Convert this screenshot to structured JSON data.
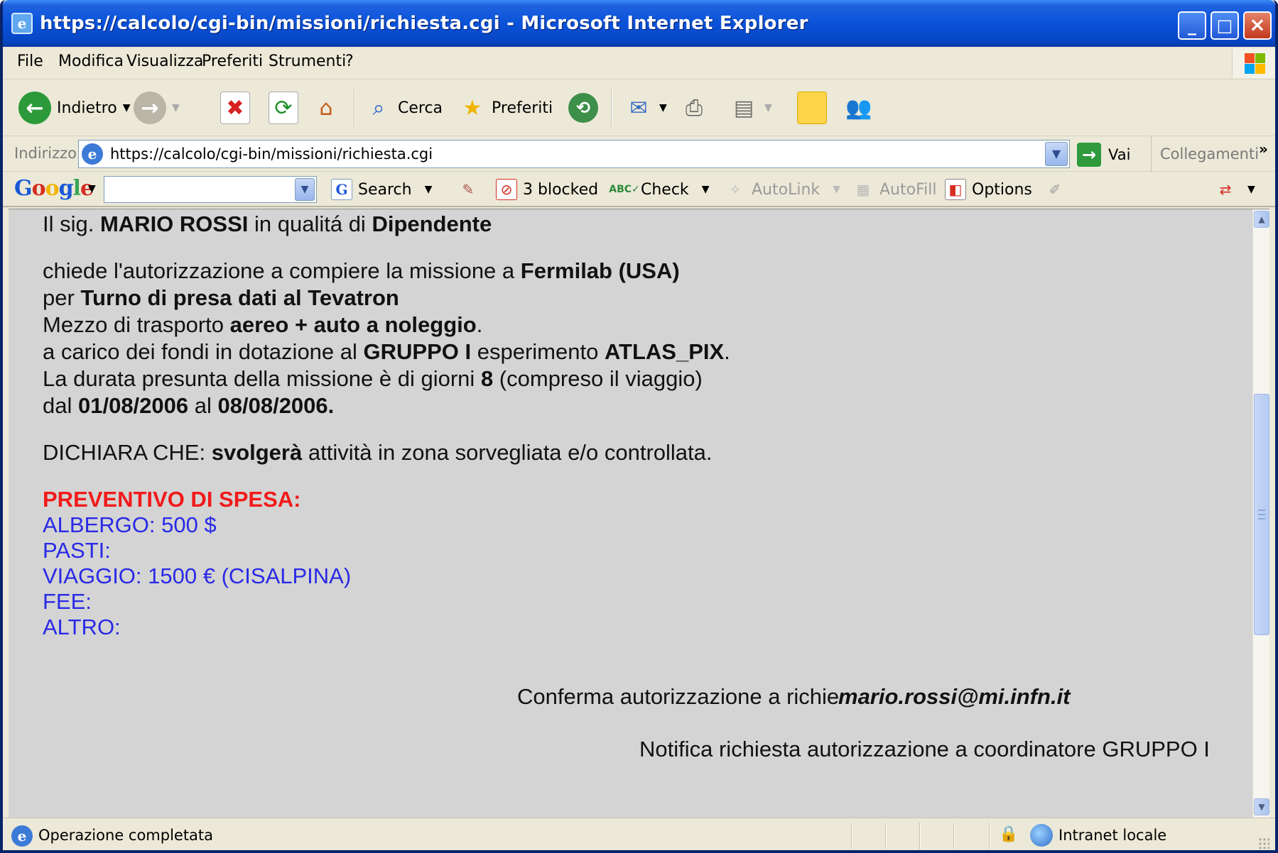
{
  "window": {
    "title": "https://calcolo/cgi-bin/missioni/richiesta.cgi - Microsoft Internet Explorer"
  },
  "menu": [
    "File",
    "Modifica",
    "Visualizza",
    "Preferiti",
    "Strumenti",
    "?"
  ],
  "toolbar": {
    "back_label": "Indietro",
    "search_label": "Cerca",
    "favorites_label": "Preferiti"
  },
  "address": {
    "label": "Indirizzo",
    "url": "https://calcolo/cgi-bin/missioni/richiesta.cgi",
    "go_label": "Vai",
    "links_label": "Collegamenti"
  },
  "google_toolbar": {
    "logo": "Google",
    "search_value": "",
    "search_label": "Search",
    "blocked_label": "3 blocked",
    "check_label": "Check",
    "autolink_label": "AutoLink",
    "autofill_label": "AutoFill",
    "options_label": "Options"
  },
  "page": {
    "l1_pre": "Il sig. ",
    "name": "MARIO ROSSI",
    "l1_mid": " in qualitá di ",
    "role": "Dipendente",
    "l2_pre": "chiede l'autorizzazione a compiere la missione a ",
    "destination": "Fermilab (USA)",
    "l3_pre": "per ",
    "purpose": "Turno di presa dati al Tevatron",
    "l4_pre": "Mezzo di trasporto ",
    "transport": "aereo + auto a noleggio",
    "l4_post": ".",
    "l5_pre": "a carico dei fondi in dotazione al ",
    "group": "GRUPPO I",
    "l5_mid": " esperimento ",
    "experiment": "ATLAS_PIX",
    "l5_post": ".",
    "l6_pre": "La durata presunta della missione è di giorni ",
    "days": "8",
    "l6_post": " (compreso il viaggio)",
    "l7_pre": "dal ",
    "date_from": "01/08/2006",
    "l7_mid": " al ",
    "date_to": "08/08/2006.",
    "l8_pre": "DICHIARA CHE: ",
    "will": "svolgerà",
    "l8_post": " attività in zona sorvegliata e/o controllata.",
    "estimate_title": "PREVENTIVO DI SPESA:",
    "expenses": [
      "ALBERGO: 500 $",
      "PASTI:",
      "VIAGGIO: 1500 € (CISALPINA)",
      "FEE:",
      "ALTRO:"
    ],
    "confirm_label": "Conferma autorizzazione a richiedente:",
    "email": "mario.rossi@mi.infn.it",
    "notify_label": "Notifica richiesta autorizzazione a coordinatore GRUPPO I"
  },
  "status": {
    "text": "Operazione completata",
    "zone": "Intranet locale"
  }
}
